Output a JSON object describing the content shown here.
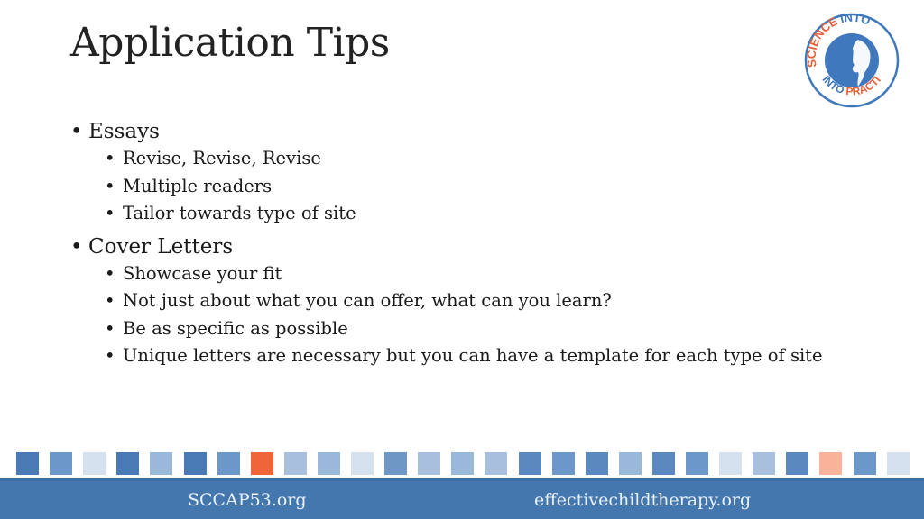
{
  "slide": {
    "title": "Application Tips",
    "logo": {
      "icon": "science-into-practice-logo-icon",
      "ring_text_top": "SCIENCE INTO",
      "ring_text_right": "PRACTICE",
      "ring_text_bottom": "INTO",
      "colors": {
        "blue": "#3f78bd",
        "orange": "#e8613a"
      }
    },
    "bullets": [
      {
        "label": "Essays",
        "children": [
          "Revise, Revise, Revise",
          "Multiple readers",
          "Tailor towards type of site"
        ]
      },
      {
        "label": "Cover Letters",
        "children": [
          "Showcase your fit",
          "Not just about what you can offer, what can you learn?",
          "Be as specific as possible",
          "Unique letters are necessary but you can have a template for each type of site"
        ]
      }
    ],
    "bullet_glyph": "•"
  },
  "decoration": {
    "square_colors": [
      "#4a7ab5",
      "#6b98c8",
      "#d5e1ee",
      "#4a7ab5",
      "#9ab8da",
      "#4a7ab5",
      "#6b98c8",
      "#ef6438",
      "#a8c0de",
      "#9ab8da",
      "#d5e1ee",
      "#6e97c6",
      "#a8c0de",
      "#9ab8da",
      "#a8c0de",
      "#5a88bf",
      "#6b98c8",
      "#5a88bf",
      "#9ab8da",
      "#5a88bf",
      "#6b98c8",
      "#d5e1ee",
      "#a8c0de",
      "#5a88bf",
      "#f8b39a",
      "#6b98c8",
      "#d5e1ee"
    ]
  },
  "footer": {
    "left_link": "SCCAP53.org",
    "right_link": "effectivechildtherapy.org",
    "background": "#4477ad"
  }
}
